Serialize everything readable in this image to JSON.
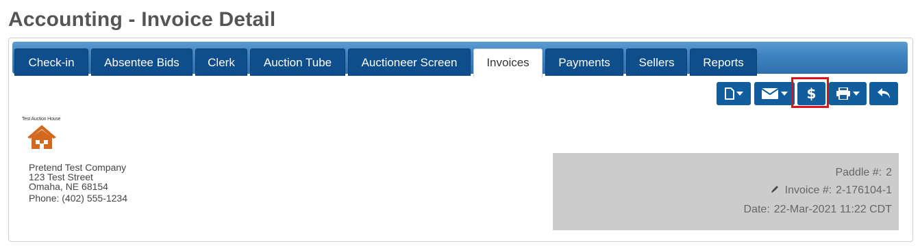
{
  "page": {
    "title": "Accounting - Invoice Detail"
  },
  "tabs": [
    {
      "label": "Check-in"
    },
    {
      "label": "Absentee Bids"
    },
    {
      "label": "Clerk"
    },
    {
      "label": "Auction Tube"
    },
    {
      "label": "Auctioneer Screen"
    },
    {
      "label": "Invoices",
      "active": true
    },
    {
      "label": "Payments"
    },
    {
      "label": "Sellers"
    },
    {
      "label": "Reports"
    }
  ],
  "toolbar": {
    "buttons": [
      {
        "icon": "document-icon",
        "dropdown": true
      },
      {
        "icon": "envelope-icon",
        "dropdown": true
      },
      {
        "icon": "dollar-icon",
        "glyph": "$",
        "highlighted": true
      },
      {
        "icon": "printer-icon",
        "dropdown": true
      },
      {
        "icon": "reply-arrow-icon"
      }
    ],
    "highlight_color": "#e0101a"
  },
  "company": {
    "logo_text": "Test Auction House",
    "logo_icon": "house-icon",
    "logo_color": "#d2691e",
    "name": "Pretend Test Company",
    "street": "123 Test Street",
    "city_state_zip": "Omaha, NE 68154",
    "phone": "Phone: (402) 555-1234"
  },
  "invoice": {
    "paddle_label": "Paddle #:",
    "paddle_value": "2",
    "invoice_label": "Invoice #:",
    "invoice_value": "2-176104-1",
    "date_label": "Date:",
    "date_value": "22-Mar-2021 11:22 CDT"
  },
  "colors": {
    "tab_bg": "#0f4e8c",
    "tabbar_gradient_top": "#5d9cd0",
    "button_bg": "#115d9e",
    "title_color": "#555555",
    "info_box_bg": "#cccccc"
  }
}
